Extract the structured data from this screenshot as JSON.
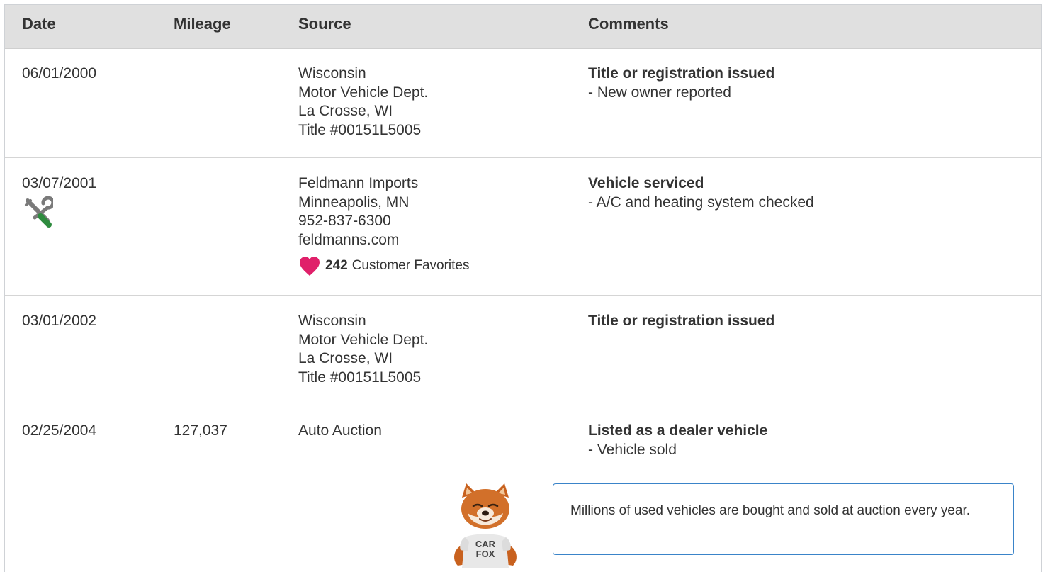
{
  "headers": {
    "date": "Date",
    "mileage": "Mileage",
    "source": "Source",
    "comments": "Comments"
  },
  "rows": [
    {
      "date": "06/01/2000",
      "mileage": "",
      "source": [
        "Wisconsin",
        "Motor Vehicle Dept.",
        "La Crosse, WI",
        "Title #00151L5005"
      ],
      "comment_title": "Title or registration issued",
      "comment_detail": "- New owner reported"
    },
    {
      "date": "03/07/2001",
      "mileage": "",
      "icon": "service-tools-icon",
      "source": [
        "Feldmann Imports",
        "Minneapolis, MN",
        "952-837-6300",
        "feldmanns.com"
      ],
      "favorites_count": "242",
      "favorites_label": "Customer Favorites",
      "comment_title": "Vehicle serviced",
      "comment_detail": "- A/C and heating system checked"
    },
    {
      "date": "03/01/2002",
      "mileage": "",
      "source": [
        "Wisconsin",
        "Motor Vehicle Dept.",
        "La Crosse, WI",
        "Title #00151L5005"
      ],
      "comment_title": "Title or registration issued",
      "comment_detail": ""
    },
    {
      "date": "02/25/2004",
      "mileage": "127,037",
      "source": [
        "Auto Auction"
      ],
      "comment_title": "Listed as a dealer vehicle",
      "comment_detail": "- Vehicle sold"
    }
  ],
  "tip": {
    "text": "Millions of used vehicles are bought and sold at auction every year.",
    "mascot": "carfox-mascot",
    "mascot_shirt": "CAR FOX"
  },
  "colors": {
    "heart": "#e0206a",
    "tip_border": "#3a84c9",
    "header_bg": "#e0e0e0"
  }
}
